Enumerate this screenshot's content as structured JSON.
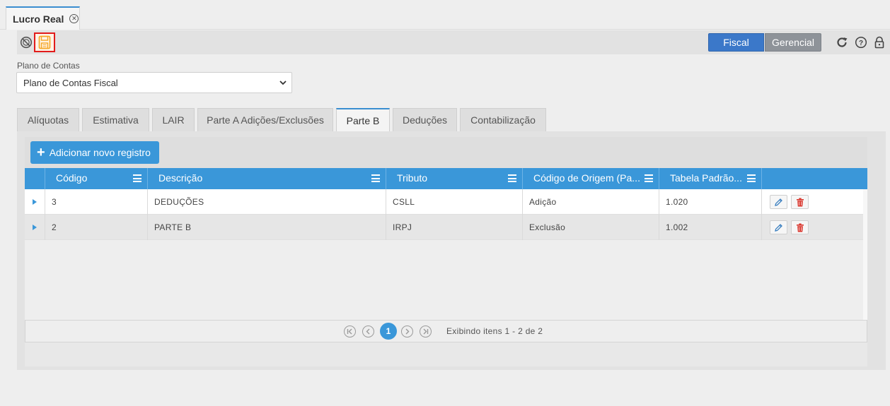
{
  "window": {
    "doc_tab_label": "Lucro Real"
  },
  "toolbar": {
    "cancel_icon": "cancel-circle-icon",
    "save_icon": "floppy-save-icon",
    "segments": [
      "Fiscal",
      "Gerencial"
    ],
    "active_segment": "Fiscal",
    "right_icons": [
      "refresh-icon",
      "help-icon",
      "lock-icon"
    ]
  },
  "plano": {
    "label": "Plano de Contas",
    "selected": "Plano de Contas Fiscal"
  },
  "tabs": [
    {
      "label": "Alíquotas"
    },
    {
      "label": "Estimativa"
    },
    {
      "label": "LAIR"
    },
    {
      "label": "Parte A Adições/Exclusões"
    },
    {
      "label": "Parte B"
    },
    {
      "label": "Deduções"
    },
    {
      "label": "Contabilização"
    }
  ],
  "active_tab": "Parte B",
  "grid": {
    "add_button_label": "Adicionar novo registro",
    "columns": [
      "Código",
      "Descrição",
      "Tributo",
      "Código de Origem (Pa...",
      "Tabela Padrão..."
    ],
    "rows": [
      {
        "codigo": "3",
        "descricao": "DEDUÇÕES",
        "tributo": "CSLL",
        "origem": "Adição",
        "tabela": "1.020"
      },
      {
        "codigo": "2",
        "descricao": "PARTE B",
        "tributo": "IRPJ",
        "origem": "Exclusão",
        "tabela": "1.002"
      }
    ]
  },
  "pager": {
    "current_page": "1",
    "info": "Exibindo itens 1 - 2 de 2"
  },
  "colors": {
    "accent": "#3a97d9",
    "fiscal": "#3b78c9",
    "gerencial": "#8e9399",
    "save_highlight": "#e21b1b",
    "save_icon": "#f5a623",
    "delete": "#d9342b"
  }
}
